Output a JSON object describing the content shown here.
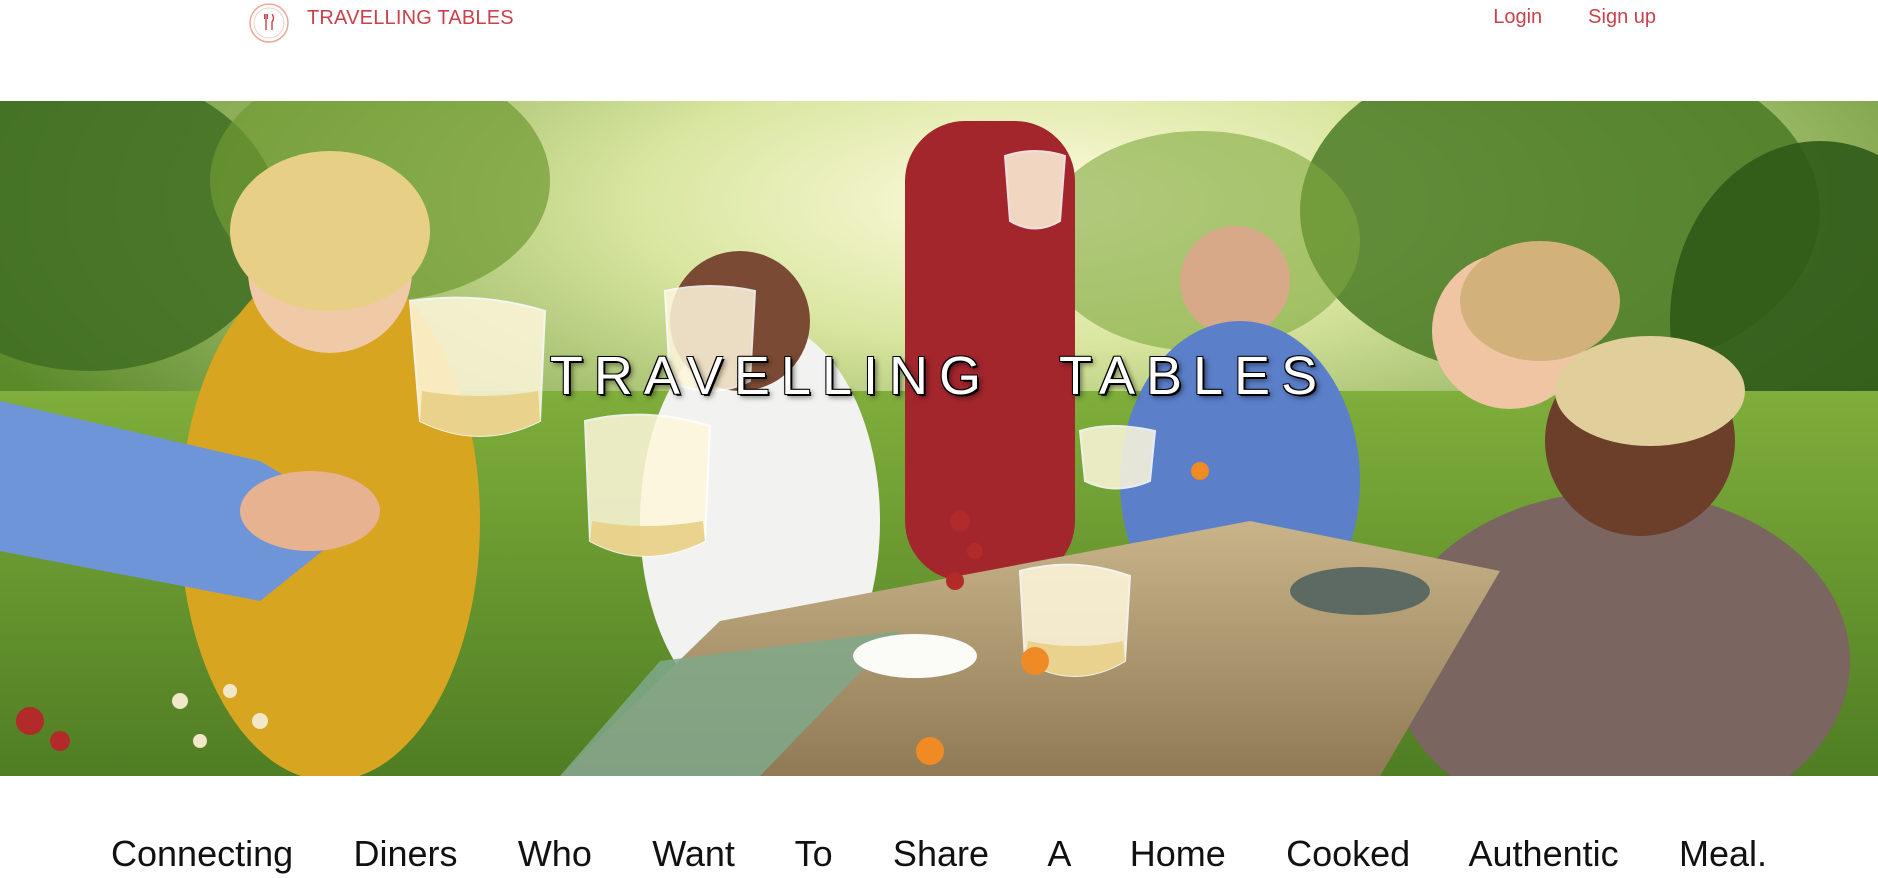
{
  "navbar": {
    "brand_name": "TRAVELLING TABLES",
    "logo_icon": "fork-knife-plate-logo-icon",
    "login_label": "Login",
    "signup_label": "Sign up",
    "accent_color": "#c9414b"
  },
  "hero": {
    "title": "TRAVELLING TABLES",
    "image_description_icon": "friends-toasting-dinner-photo"
  },
  "tagline": {
    "text": "Connecting Diners Who Want To Share A Home Cooked Authentic Meal."
  }
}
